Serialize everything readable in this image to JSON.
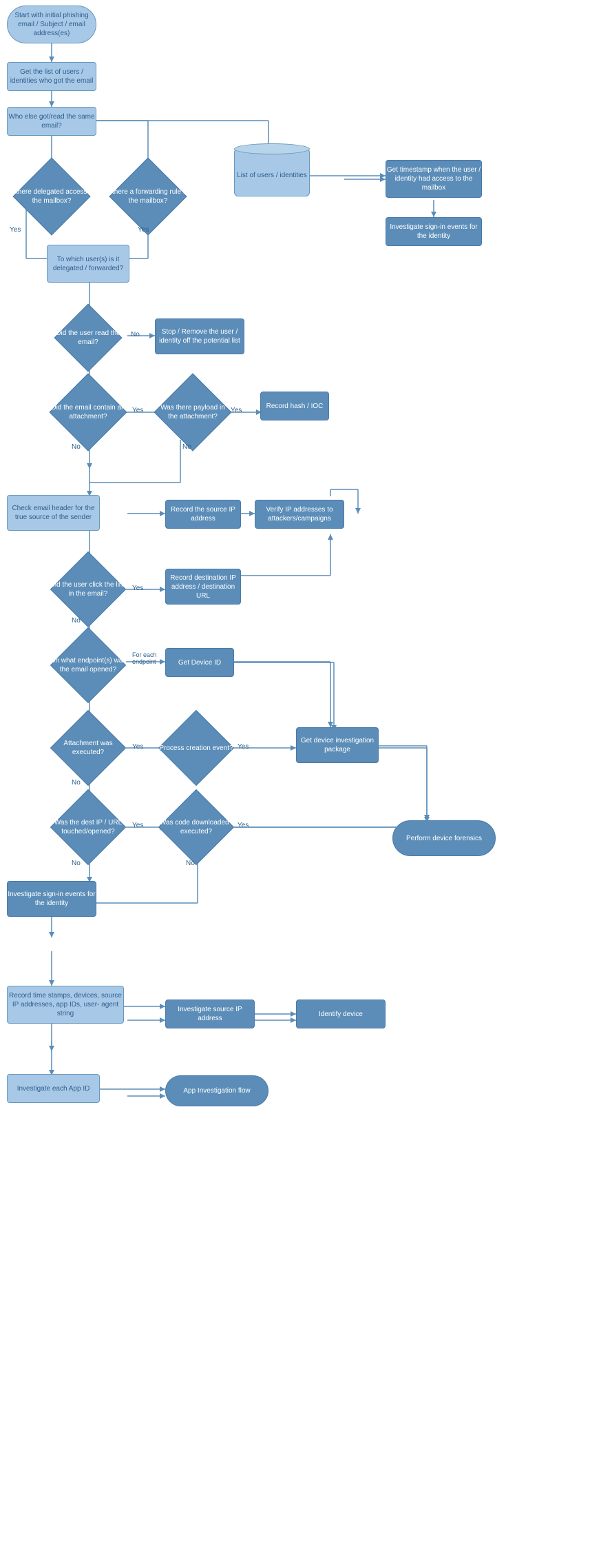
{
  "nodes": {
    "start": "Start with\ninitial phishing email / Subject /\nemail address(es)",
    "n1": "Get the list of users /\nidentities who got the email",
    "n2": "Who else got/read the same\nemail?",
    "d_delegated": "Is there delegated\naccess to the mailbox?",
    "d_forwarding": "Is there a forwarding\nrule for the mailbox?",
    "cyl_users": "List of users /\nidentities",
    "n3": "Get timestamp when the\nuser / identity had access to\nthe mailbox",
    "n4": "Investigate sign-in\nevents for the identity",
    "n5": "To which user(s) is it\ndelegated /\nforwarded?",
    "d_read": "Did the user read the\nemail?",
    "n6": "Stop / Remove the user /\nidentity off the potential\nlist",
    "d_attachment": "Did the email\ncontain an\nattachment?",
    "d_payload": "Was there payload in\nthe attachment?",
    "n7": "Record hash\n/ IOC",
    "n8": "Check email header for\nthe true source of\nthe sender",
    "n9": "Record the source IP\naddress",
    "n10": "Verify IP addresses to\nattackers/campaigns",
    "d_link": "Did the user click the\nlink in the email?",
    "n11": "Record destination IP\naddress /\ndestination URL",
    "d_endpoint": "On what endpoint(s)\nwas the email opened?",
    "n12": "Get Device ID",
    "d_attachment_exec": "Attachment was\nexecuted?",
    "d_process": "Process creation event?",
    "n13": "Get device\ninvestigation package",
    "oval_forensics": "Perform device forensics",
    "d_dest_ip": "Was the dest IP / URL\ntouched/opened?",
    "d_code": "Was code\ndownloaded /\nexecuted?",
    "n14": "Investigate sign-in\nevents for the identity",
    "n15": "Record time stamps, devices,\nsource IP addresses, app IDs, user-\nagent string",
    "n16": "Investigate source IP\naddress",
    "n17": "Identify device",
    "n18": "Investigate each App ID",
    "oval_app": "App Investigation flow",
    "lbl_yes1": "Yes",
    "lbl_yes2": "Yes",
    "lbl_no1": "No",
    "lbl_no2": "No",
    "lbl_no3": "No",
    "lbl_yes3": "Yes",
    "lbl_yes4": "Yes",
    "lbl_no4": "No",
    "lbl_yes5": "Yes",
    "lbl_no5": "No",
    "lbl_foreach": "For each\nendpoint",
    "lbl_yes6": "Yes",
    "lbl_no6": "No",
    "lbl_yes7": "Yes",
    "lbl_no7": "No",
    "lbl_yes8": "Yes"
  }
}
